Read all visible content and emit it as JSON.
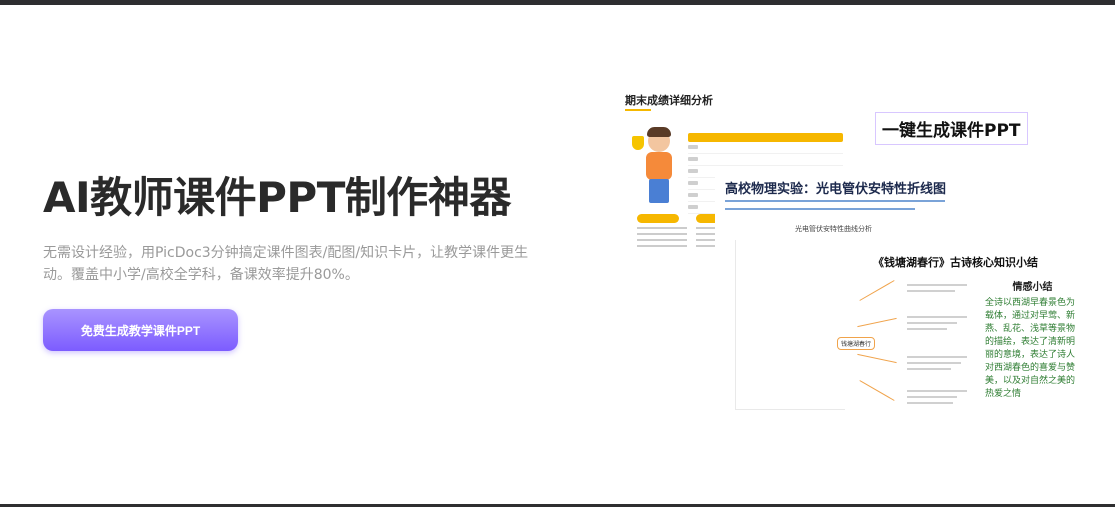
{
  "hero": {
    "title": "AI教师课件PPT制作神器",
    "description": "无需设计经验，用PicDoc3分钟搞定课件图表/配图/知识卡片，让教学课件更生动。覆盖中小学/高校全学科，备课效率提升80%。",
    "cta_label": "免费生成教学课件PPT"
  },
  "preview": {
    "score_card": {
      "title": "期末成绩详细分析"
    },
    "badge": "一键生成课件PPT",
    "physics_card": {
      "title": "高校物理实验：光电管伏安特性折线图",
      "chart_title": "光电管伏安特性曲线分析"
    },
    "poem_card": {
      "title": "《钱塘湖春行》古诗核心知识小结",
      "center": "钱塘湖春行",
      "summary_title": "情感小结",
      "summary_text": "全诗以西湖早春景色为载体，通过对早莺、新燕、乱花、浅草等景物的描绘，表达了清新明丽的意境，表达了诗人对西湖春色的喜爱与赞美，以及对自然之美的热爱之情"
    }
  },
  "colors": {
    "accent_gradient_start": "#a994ff",
    "accent_gradient_end": "#7c5cff",
    "top_bar": "#2e2e30",
    "table_header": "#f6b700"
  }
}
